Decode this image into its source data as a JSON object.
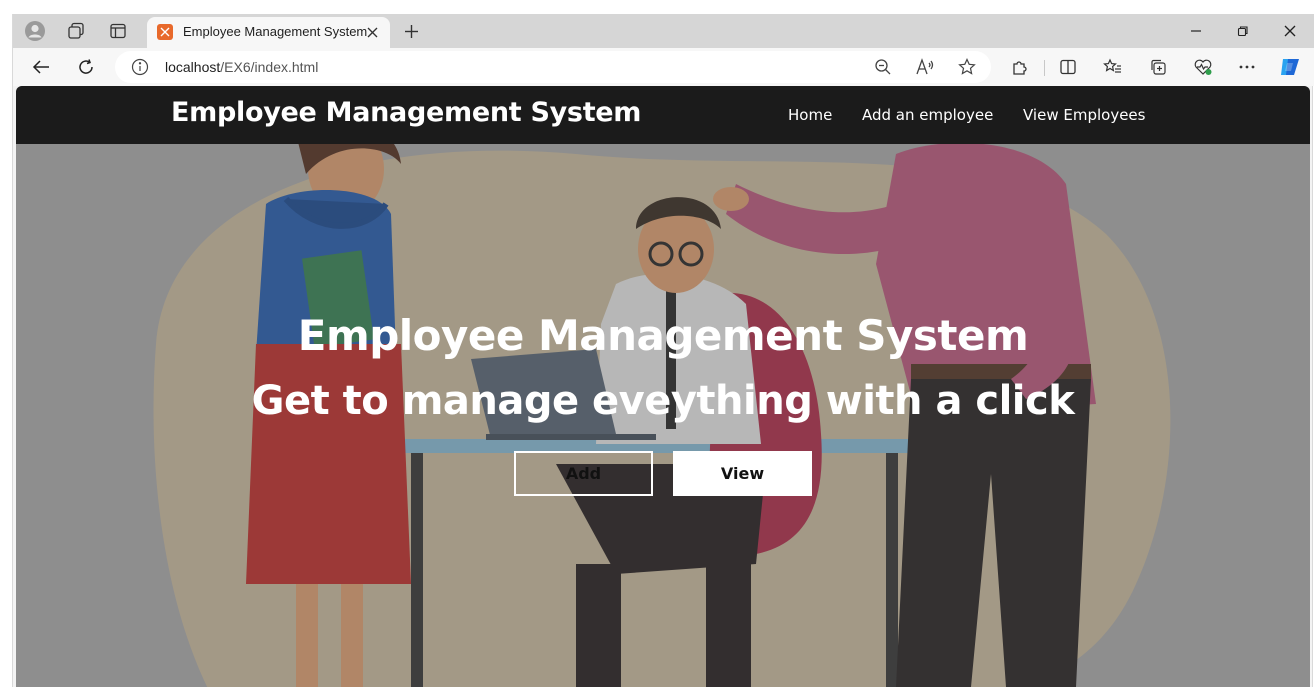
{
  "browser": {
    "tab": {
      "title": "Employee Management System"
    },
    "address": {
      "host": "localhost",
      "path": "/EX6/index.html"
    }
  },
  "site": {
    "brand": "Employee Management System",
    "nav": [
      {
        "label": "Home"
      },
      {
        "label": "Add an employee"
      },
      {
        "label": "View Employees"
      }
    ]
  },
  "hero": {
    "title": "Employee Management System",
    "subtitle": "Get to manage eveything with a click",
    "add_label": "Add",
    "view_label": "View"
  },
  "colors": {
    "navbar_bg": "#1b1b1b",
    "favicon": "#e8692b",
    "copilot": "#1e90ff"
  },
  "icons": [
    "profile-icon",
    "workspaces-icon",
    "vertical-tabs-icon",
    "favicon-icon",
    "close-icon",
    "plus-icon",
    "minimize-icon",
    "restore-icon",
    "back-icon",
    "refresh-icon",
    "info-icon",
    "zoom-out-icon",
    "read-aloud-icon",
    "star-icon",
    "extensions-icon",
    "split-screen-icon",
    "favorites-icon",
    "collections-icon",
    "browser-essentials-icon",
    "more-icon",
    "copilot-icon"
  ]
}
